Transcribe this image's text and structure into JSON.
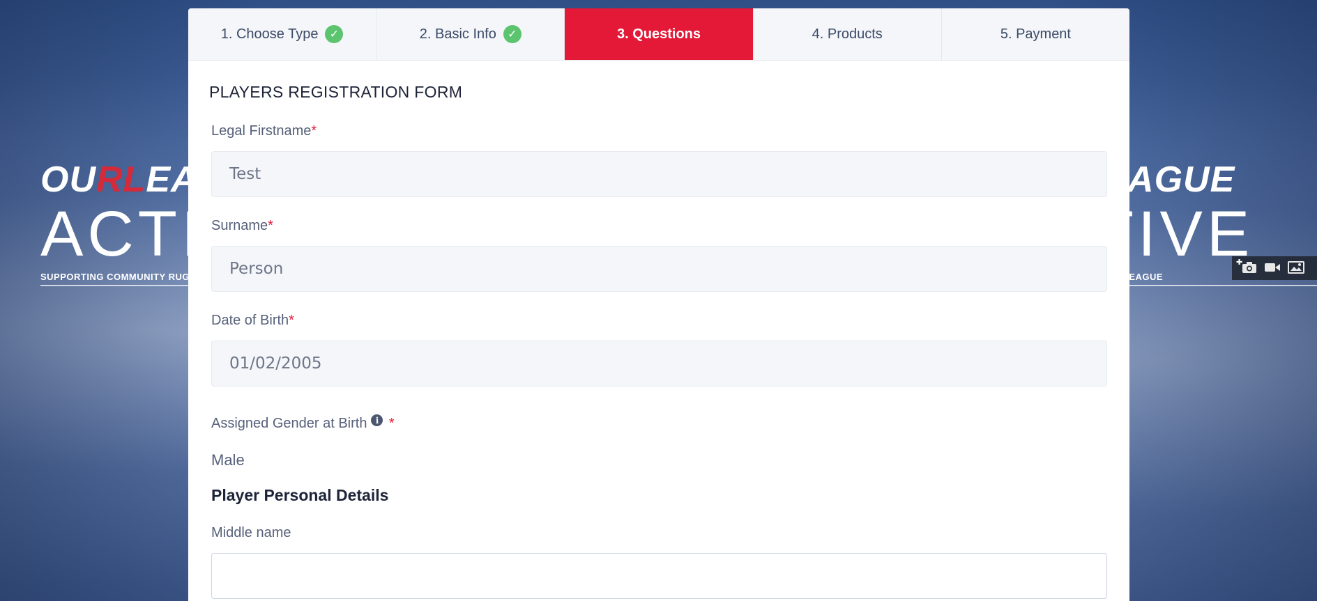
{
  "background": {
    "brand_prefix": "OU",
    "brand_rl": "RL",
    "brand_suffix": "EAGUE",
    "brand_big": "ACTIVE",
    "brand_tagline": "SUPPORTING COMMUNITY RUGBY LEAGUE"
  },
  "media_bar": {
    "icons": [
      "add-icon",
      "camera-icon",
      "video-icon",
      "image-icon"
    ]
  },
  "steps": [
    {
      "label": "1. Choose Type",
      "completed": true
    },
    {
      "label": "2. Basic Info",
      "completed": true
    },
    {
      "label": "3. Questions",
      "active": true
    },
    {
      "label": "4. Products"
    },
    {
      "label": "5. Payment"
    }
  ],
  "form": {
    "title": "PLAYERS REGISTRATION FORM",
    "legal_firstname": {
      "label": "Legal Firstname",
      "required": "*",
      "value": "Test"
    },
    "surname": {
      "label": "Surname",
      "required": "*",
      "value": "Person"
    },
    "dob": {
      "label": "Date of Birth",
      "required": "*",
      "value": "01/02/2005"
    },
    "gender": {
      "label": "Assigned Gender at Birth",
      "required": "*",
      "value": "Male"
    },
    "section_personal": "Player Personal Details",
    "middle_name": {
      "label": "Middle name",
      "value": ""
    }
  },
  "colors": {
    "accent": "#e31937",
    "check": "#5cc46e",
    "step_bg": "#f4f6fa"
  }
}
